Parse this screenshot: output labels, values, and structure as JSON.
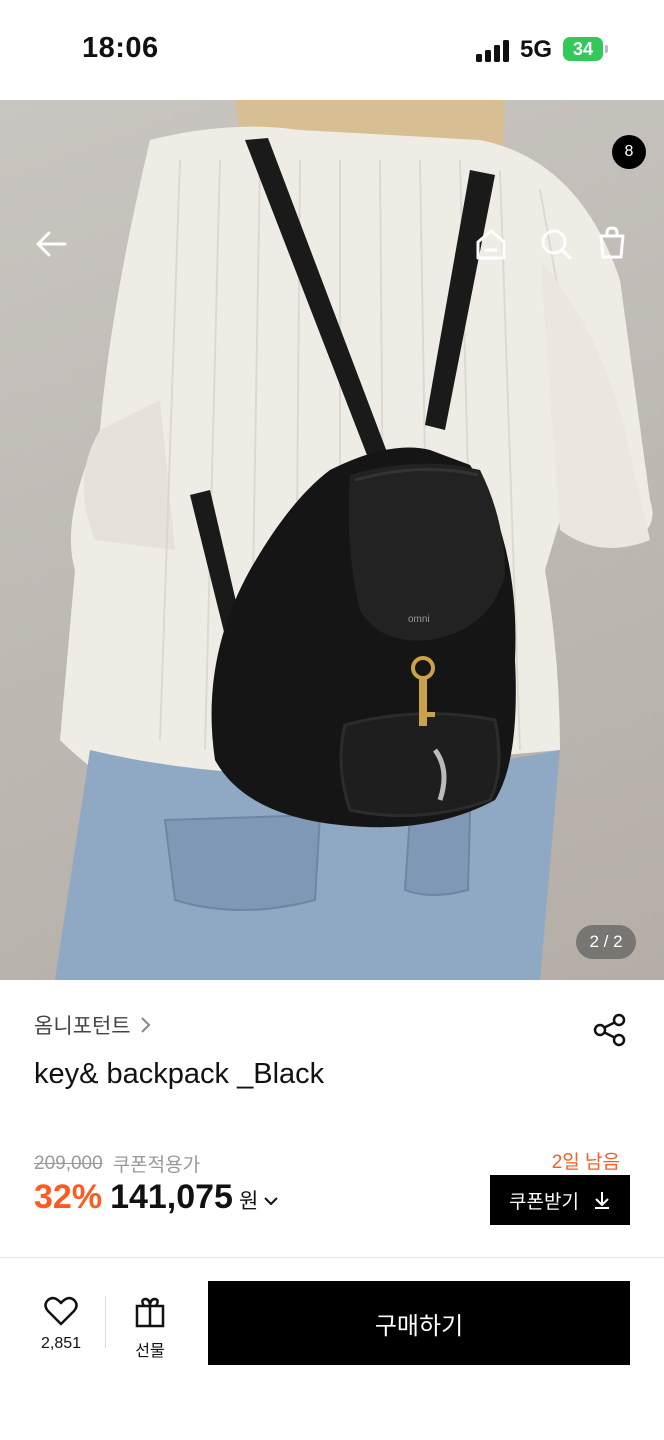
{
  "status_bar": {
    "time": "18:06",
    "network": "5G",
    "battery": "34"
  },
  "hero": {
    "pager": "2 / 2",
    "cart_count": "8"
  },
  "product": {
    "brand": "옴니포턴트",
    "title": "key& backpack _Black",
    "original_price": "209,000",
    "coupon_note": "쿠폰적용가",
    "discount": "32%",
    "price": "141,075",
    "currency": "원",
    "days_left": "2일 남음",
    "coupon_button": "쿠폰받기"
  },
  "bottom_bar": {
    "like_count": "2,851",
    "gift_label": "선물",
    "buy_label": "구매하기"
  },
  "colors": {
    "accent": "#ff5a1f",
    "primary": "#000000",
    "battery": "#34c759"
  },
  "icons": [
    "back-arrow-icon",
    "home-icon",
    "search-icon",
    "shopping-bag-icon",
    "share-icon",
    "heart-icon",
    "gift-icon",
    "download-icon",
    "chevron-right-icon",
    "chevron-down-icon"
  ]
}
